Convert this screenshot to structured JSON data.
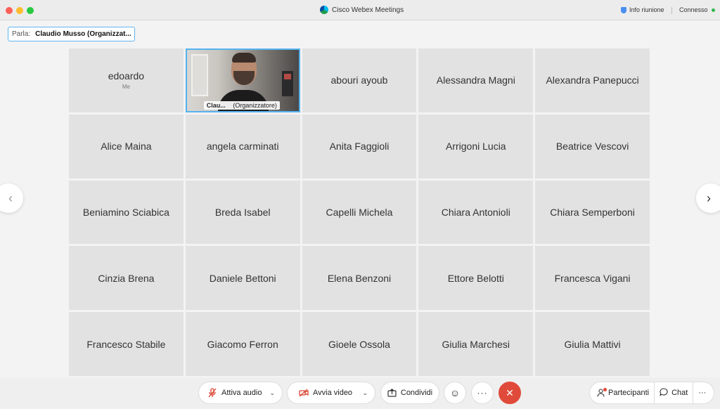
{
  "window": {
    "title": "Cisco Webex Meetings",
    "info_label": "Info riunione",
    "status": "Connesso"
  },
  "speaking": {
    "label": "Parla:",
    "name": "Claudio Musso (Organizzat..."
  },
  "participants": [
    {
      "name": "edoardo",
      "sub": "Me"
    },
    {
      "name": "Clau...",
      "role": "(Organizzatore)",
      "video": true
    },
    {
      "name": "abouri ayoub"
    },
    {
      "name": "Alessandra Magni"
    },
    {
      "name": "Alexandra Panepucci"
    },
    {
      "name": "Alice Maina"
    },
    {
      "name": "angela carminati"
    },
    {
      "name": "Anita Faggioli"
    },
    {
      "name": "Arrigoni Lucia"
    },
    {
      "name": "Beatrice Vescovi"
    },
    {
      "name": "Beniamino Sciabica"
    },
    {
      "name": "Breda Isabel"
    },
    {
      "name": "Capelli Michela"
    },
    {
      "name": "Chiara Antonioli"
    },
    {
      "name": "Chiara Semperboni"
    },
    {
      "name": "Cinzia Brena"
    },
    {
      "name": "Daniele Bettoni"
    },
    {
      "name": "Elena Benzoni"
    },
    {
      "name": "Ettore Belotti"
    },
    {
      "name": "Francesca Vigani"
    },
    {
      "name": "Francesco Stabile"
    },
    {
      "name": "Giacomo Ferron"
    },
    {
      "name": "Gioele Ossola"
    },
    {
      "name": "Giulia Marchesi"
    },
    {
      "name": "Giulia Mattivi"
    }
  ],
  "controls": {
    "audio_label": "Attiva audio",
    "video_label": "Avvia video",
    "share_label": "Condividi",
    "more_label": "···",
    "end_icon": "✕",
    "participants_label": "Partecipanti",
    "chat_label": "Chat",
    "overflow_label": "···"
  },
  "icons": {
    "mic": "mic-off-icon",
    "video": "video-off-icon",
    "share": "share-icon",
    "emoji": "emoji-icon",
    "end": "end-call-icon",
    "participants": "participants-icon",
    "chat": "chat-icon"
  },
  "colors": {
    "accent": "#55b2ef",
    "end_call": "#e04a3a",
    "connected": "#2eb84b"
  }
}
